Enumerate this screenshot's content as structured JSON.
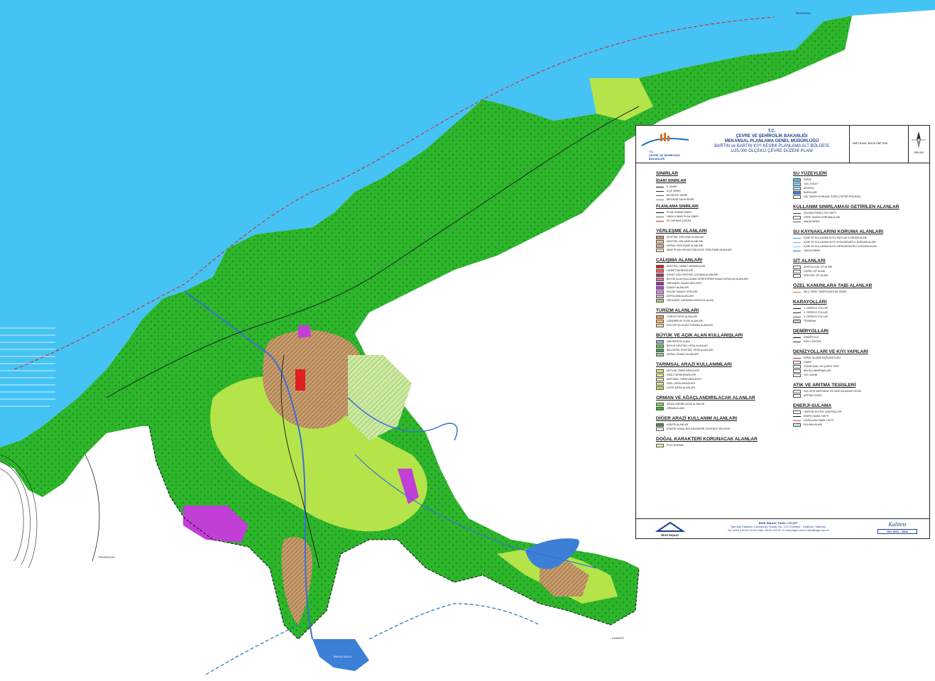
{
  "colors": {
    "sea": "#45c3f4",
    "forest": "#2db52b",
    "agriculture": "#b4e44a",
    "urban": "#c79c6c",
    "industry": "#c23fd6",
    "reservoir": "#3b7fd6",
    "river": "#3a6fd9"
  },
  "map_labels": {
    "bottom_left": "TEKKEKAYA",
    "reservoir": "BARAJ GÖLÜ",
    "north_cape": "TEKKEÖNÜ",
    "east_label": "KUMKÖY"
  },
  "panel": {
    "header": {
      "ministry_lines": [
        "T.C.",
        "ÇEVRE VE ŞEHİRCİLİK BAKANLIĞI",
        "MEKANSAL PLANLAMA GENEL MÜDÜRLÜĞÜ"
      ],
      "plan_lines": [
        "BARTIN ve BARTIN KIYI KESİMİ PLANLAMA ALT BÖLGESİ",
        "1/25.000 ÖLÇEKLİ ÇEVRE DÜZENİ PLANI"
      ],
      "logo_text": "T.C.\nÇEVRE VE ŞEHİRCİLİK\nBAKANLIĞI",
      "sheet_label": "PAFTA ADI: BİLGİ PAFTASI",
      "scale": "1/50.000",
      "north_icon": "north-arrow-icon"
    },
    "left_column": [
      {
        "title": "SINIRLAR",
        "sub": "İDARİ SINIRLAR",
        "items": [
          {
            "label": "İL SINIRI",
            "kind": "line",
            "color": "#111111"
          },
          {
            "label": "İLÇE SINIRI",
            "kind": "line",
            "color": "#333333"
          },
          {
            "label": "BELEDİYE SINIRI",
            "kind": "line",
            "color": "#555555"
          },
          {
            "label": "MÜCAVİR SAHA SINIRI",
            "kind": "line",
            "color": "#777777"
          }
        ]
      },
      {
        "title": "",
        "sub": "PLANLAMA SINIRLARI",
        "items": [
          {
            "label": "PLAN ONAMA SINIRI",
            "kind": "line",
            "color": "#111111"
          },
          {
            "label": "ONAYLI İMAR PLAN SINIRI",
            "kind": "line",
            "color": "#666666"
          },
          {
            "label": "KIYI KENAR ÇİZGİSİ",
            "kind": "line",
            "color": "#e02020"
          }
        ]
      },
      {
        "title": "YERLEŞME ALANLARI",
        "sub": "",
        "items": [
          {
            "label": "KENTSEL YERLEŞİK ALANLAR",
            "kind": "box",
            "color": "#c79c6c"
          },
          {
            "label": "KENTSEL GELİŞME ALANLARI",
            "kind": "box",
            "color": "#e8c59a"
          },
          {
            "label": "KIRSAL YERLEŞME ALANLARI",
            "kind": "box",
            "color": "#d9b38a"
          },
          {
            "label": "İMAR PLANI REVİZE EDİLECEK YERLEŞME ALANLARI",
            "kind": "box",
            "color": "#f0e0c0"
          }
        ]
      },
      {
        "title": "ÇALIŞMA ALANLARI",
        "sub": "",
        "items": [
          {
            "label": "KENTSEL HİZMET MERKEZLERİ",
            "kind": "box",
            "color": "#e02020"
          },
          {
            "label": "HİZMET MERKEZLERİ",
            "kind": "box",
            "color": "#f06060"
          },
          {
            "label": "KONUT DIŞI KENTSEL ÇALIŞMA ALANLARI",
            "kind": "box",
            "color": "#b03060"
          },
          {
            "label": "BÜYÜK ALAN KULLANIMI GEREKTİREN KAMU KURULUŞ ALANLARI",
            "kind": "box",
            "color": "#d080a0"
          },
          {
            "label": "ORGANİZE SANAYİ BÖLGESİ",
            "kind": "box",
            "color": "#9a2ab5"
          },
          {
            "label": "SANAYİ ALANLARI",
            "kind": "box",
            "color": "#c23fd6"
          },
          {
            "label": "KÜÇÜK SANAYİ SİTELERİ",
            "kind": "box",
            "color": "#e090e8"
          },
          {
            "label": "DEPOLAMA ALANLARI",
            "kind": "box",
            "color": "#d8b0e0"
          },
          {
            "label": "ORGANİZE TARIM/HAYVANCILIK ALANI",
            "kind": "box",
            "color": "#a0d070"
          }
        ]
      },
      {
        "title": "TURİZM ALANLARI",
        "sub": "",
        "items": [
          {
            "label": "TURİZM TESİS ALANLARI",
            "kind": "box",
            "color": "#f0a040"
          },
          {
            "label": "GÜNÜBİRLİK TESİS ALANLARI",
            "kind": "box",
            "color": "#f5c070"
          },
          {
            "label": "KÜLTÜR VE DOĞA TURİZMİ ALANLARI",
            "kind": "box",
            "color": "#f8d898"
          }
        ]
      },
      {
        "title": "BÜYÜK VE AÇIK ALAN KULLANIŞLARI",
        "sub": "",
        "items": [
          {
            "label": "ÜNİVERSİTE ALANI",
            "kind": "box",
            "color": "#8fb0e0"
          },
          {
            "label": "BÜYÜK KENTSEL YEŞİL ALANLAR",
            "kind": "box",
            "color": "#70c050"
          },
          {
            "label": "BÖLGESEL KENTSEL SPOR ALANLARI",
            "kind": "box",
            "color": "#40a060"
          },
          {
            "label": "DOĞAL DONATI ALANLARI",
            "kind": "box",
            "color": "#90d090"
          }
        ]
      },
      {
        "title": "TARIMSAL ARAZİ KULLANIMLARI",
        "sub": "",
        "items": [
          {
            "label": "MUTLAK TARIM ARAZİLERİ",
            "kind": "box",
            "color": "#e8e070"
          },
          {
            "label": "DİKİLİ TARIM ARAZİLERİ",
            "kind": "box",
            "color": "#f0e8a0"
          },
          {
            "label": "MARJİNAL TARIM ARAZİLERİ",
            "kind": "box",
            "color": "#f5eec0"
          },
          {
            "label": "ÖZEL ÜRÜN ARAZİLERİ",
            "kind": "box",
            "color": "#d8e890"
          },
          {
            "label": "ÇAYIR MERA ALANLARI",
            "kind": "box",
            "color": "#b4e44a"
          }
        ]
      },
      {
        "title": "ORMAN VE AĞAÇLANDIRILACAK ALANLAR",
        "sub": "",
        "items": [
          {
            "label": "AĞAÇLANDIRILACAK ALANLAR",
            "kind": "box",
            "color": "#8ad060"
          },
          {
            "label": "ORMAN ALANI",
            "kind": "box",
            "color": "#2db52b"
          }
        ]
      },
      {
        "title": "DİĞER ARAZİ KULLANIM ALANLARI",
        "sub": "",
        "items": [
          {
            "label": "ASKERİ ALANLAR",
            "kind": "box",
            "color": "#5a8a3a"
          },
          {
            "label": "ASKERİ YASAK BÖLGE/ASKERİ GÜVENLİK BÖLGESİ",
            "kind": "box",
            "color": "#ffffff"
          }
        ]
      },
      {
        "title": "DOĞAL KARAKTERİ KORUNACAK ALANLAR",
        "sub": "",
        "items": [
          {
            "label": "PLAJ-KUMSAL",
            "kind": "box",
            "color": "#f8f0a0"
          }
        ]
      }
    ],
    "right_column": [
      {
        "title": "SU YÜZEYLERİ",
        "items": [
          {
            "label": "DENİZ",
            "kind": "box",
            "color": "#45c3f4"
          },
          {
            "label": "GÖL-GÖLET",
            "kind": "box",
            "color": "#7fd3f8"
          },
          {
            "label": "AKARSU",
            "kind": "box",
            "color": "#a8e0f8"
          },
          {
            "label": "BARAJLAR",
            "kind": "box",
            "color": "#3b7fd6"
          },
          {
            "label": "DIŞ TAŞKIN KORUMA TESİSİ (TEPER PROJESİ)",
            "kind": "box",
            "color": "#ffffff"
          }
        ]
      },
      {
        "title": "KULLANIM SINIRLAMASI GETİRİLEN ALANLAR",
        "items": [
          {
            "label": "FAY/MUHTEMEL FAY HATTI",
            "kind": "line",
            "color": "#333333"
          },
          {
            "label": "DERE TAŞKIN KORUMA ALANI",
            "kind": "box",
            "color": "#ffffff"
          },
          {
            "label": "MAKİA SINIRI",
            "kind": "line",
            "color": "#555555"
          }
        ]
      },
      {
        "title": "SU KAYNAKLARINI KORUMA ALANLARI",
        "items": [
          {
            "label": "İÇME VE KULLANMA SUYU MUTLAK KORUMA ALANI",
            "kind": "line",
            "color": "#4aa0e0"
          },
          {
            "label": "İÇME VE KULLANMA SUYU KISA MESAFELİ KORUMA ALANI",
            "kind": "line",
            "color": "#6ab0e8"
          },
          {
            "label": "İÇME VE KULLANMA SUYU ORTA MESAFELİ KORUMA ALANI",
            "kind": "line",
            "color": "#8ac0f0"
          },
          {
            "label": "HAVZA SINIRI",
            "kind": "line",
            "color": "#1a70c0"
          }
        ]
      },
      {
        "title": "SİT ALANLARI",
        "items": [
          {
            "label": "ARKEOLOJİK SİT ALANI",
            "kind": "box",
            "color": "#ffffff"
          },
          {
            "label": "DOĞAL SİT ALANI",
            "kind": "box",
            "color": "#ffffff"
          },
          {
            "label": "KENTSEL SİT ALANI",
            "kind": "box",
            "color": "#ffffff"
          }
        ]
      },
      {
        "title": "ÖZEL KANUNLARA TABİ ALANLAR",
        "items": [
          {
            "label": "MİLLİ PARK TAMPON BÖLGE SINIRI",
            "kind": "line",
            "color": "#e07020"
          }
        ]
      },
      {
        "title": "KARAYOLLARI",
        "items": [
          {
            "label": "1. DERECE YOLLAR",
            "kind": "line",
            "color": "#111111"
          },
          {
            "label": "2. DERECE YOLLAR",
            "kind": "line",
            "color": "#333333"
          },
          {
            "label": "3. DERECE YOLLAR",
            "kind": "line",
            "color": "#555555"
          },
          {
            "label": "TERMİNAL",
            "kind": "box",
            "color": "#cccccc"
          }
        ]
      },
      {
        "title": "DEMİRYOLLARI",
        "items": [
          {
            "label": "DEMİRYOLU",
            "kind": "line",
            "color": "#111111"
          },
          {
            "label": "RAYLI SİSTEM",
            "kind": "line",
            "color": "#333333"
          }
        ]
      },
      {
        "title": "DENİZYOLLARI VE KIYI YAPILARI",
        "items": [
          {
            "label": "DENİZ ULAŞIM BAĞLANTILARI",
            "kind": "line",
            "color": "#e02020"
          },
          {
            "label": "LİMAN",
            "kind": "box",
            "color": "#ffffff"
          },
          {
            "label": "TEKNE İMAL VE ÇEKEK YERİ",
            "kind": "box",
            "color": "#ffffff"
          },
          {
            "label": "BALIKÇI BARINAKLARI",
            "kind": "box",
            "color": "#ffffff"
          },
          {
            "label": "YAT LİMANI",
            "kind": "box",
            "color": "#ffffff"
          }
        ]
      },
      {
        "title": "ATIK VE ARITMA TESİSLERİ",
        "items": [
          {
            "label": "KATI ATIK BERTARAF VE GERİ KAZANIM TESİSİ",
            "kind": "box",
            "color": "#ffffff"
          },
          {
            "label": "ARITMA TESİSİ",
            "kind": "box",
            "color": "#ffffff"
          }
        ]
      },
      {
        "title": "ENERJİ-SULAMA",
        "items": [
          {
            "label": "HİDROELEKTRİK SANTRALLER",
            "kind": "box",
            "color": "#ffffff"
          },
          {
            "label": "ENERJİ NAKİL HATTI",
            "kind": "line",
            "color": "#111111"
          },
          {
            "label": "DOĞALGAZ NAKİL HATTI",
            "kind": "line",
            "color": "#e04040"
          },
          {
            "label": "SULAMA ALANI",
            "kind": "box",
            "color": "#c0e8f8"
          }
        ]
      }
    ],
    "footer": {
      "logo_label": "BİGE İNŞAAT",
      "company_name": "BİGE İNŞAAT TAAH. LTD.ŞTİ",
      "address": "Şair Arşi Caddesi, Çavuşkuyu Sokak, No: 12/2 Göztepe - Kadıköy / İstanbul",
      "contact": "Tel: 0216 478 51 33-34     Faks: 0216 478 51 22     www.bige.com.tr     info@bige.com.tr",
      "cert_brand": "Kalitest",
      "cert_iso": "ISO 9001 : 2008"
    }
  }
}
